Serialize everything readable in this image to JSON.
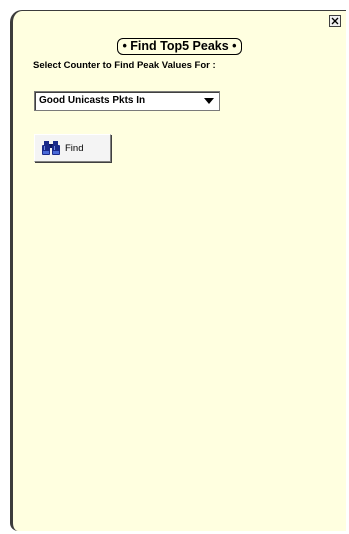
{
  "window": {
    "close_icon": "close-icon"
  },
  "panel": {
    "title": "Find Top5 Peaks",
    "select_label": "Select Counter to Find Peak Values For :"
  },
  "counter_select": {
    "selected_value": "Good Unicasts Pkts In",
    "arrow_icon": "chevron-down-icon"
  },
  "find_button": {
    "label": "Find",
    "icon": "binoculars-icon"
  },
  "colors": {
    "panel_background": "#ffffe0",
    "binoculars": "#1a2a8a"
  }
}
